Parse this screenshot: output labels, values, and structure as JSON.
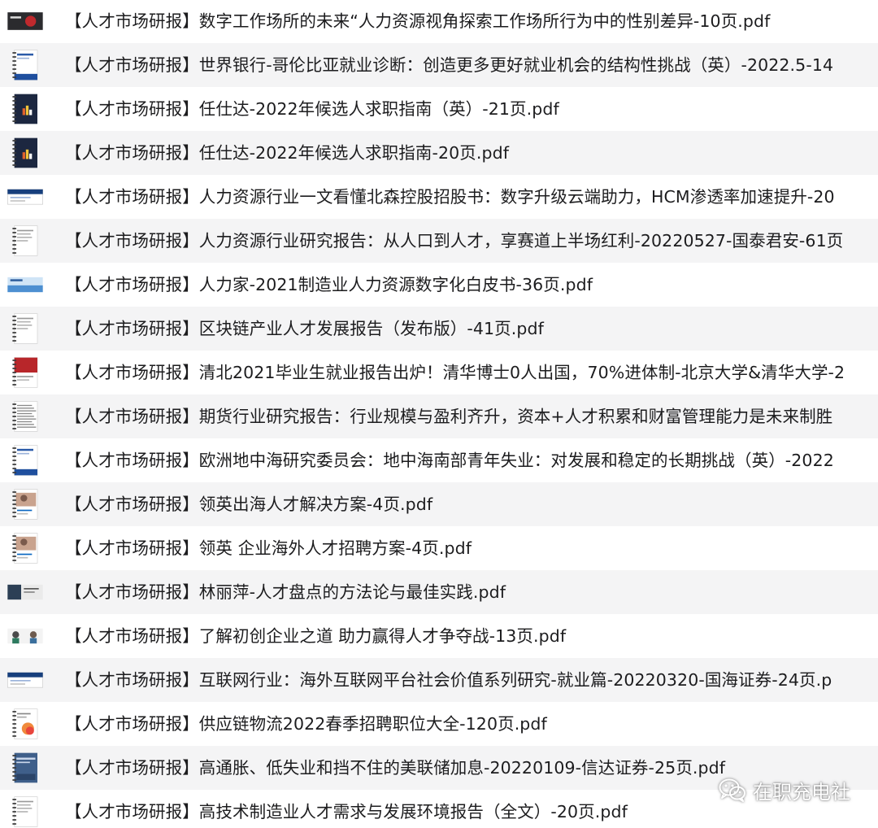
{
  "files": [
    {
      "name": "【人才市场研报】数字工作场所的未来“人力资源视角探索工作场所行为中的性别差异-10页.pdf",
      "thumb": "cover-wide-dark-red"
    },
    {
      "name": "【人才市场研报】世界银行-哥伦比亚就业诊断：创造更多更好就业机会的结构性挑战（英）-2022.5-14",
      "thumb": "doc-portrait-blue"
    },
    {
      "name": "【人才市场研报】任仕达-2022年候选人求职指南（英）-21页.pdf",
      "thumb": "cover-navy"
    },
    {
      "name": "【人才市场研报】任仕达-2022年候选人求职指南-20页.pdf",
      "thumb": "cover-navy"
    },
    {
      "name": "【人才市场研报】人力资源行业一文看懂北森控股招股书：数字升级云端助力，HCM渗透率加速提升-20",
      "thumb": "slide-wide-blue"
    },
    {
      "name": "【人才市场研报】人力资源行业研究报告：从人口到人才，享赛道上半场红利-20220527-国泰君安-61页",
      "thumb": "doc-portrait-plain"
    },
    {
      "name": "【人才市场研报】人力家-2021制造业人力资源数字化白皮书-36页.pdf",
      "thumb": "slide-wide-lightblue"
    },
    {
      "name": "【人才市场研报】区块链产业人才发展报告（发布版）-41页.pdf",
      "thumb": "doc-portrait-plain"
    },
    {
      "name": "【人才市场研报】清北2021毕业生就业报告出炉！清华博士0人出国，70%进体制-北京大学&清华大学-2",
      "thumb": "doc-portrait-red"
    },
    {
      "name": "【人才市场研报】期货行业研究报告：行业规模与盈利齐升，资本+人才积累和财富管理能力是未来制胜",
      "thumb": "doc-portrait-dense"
    },
    {
      "name": "【人才市场研报】欧洲地中海研究委员会：地中海南部青年失业：对发展和稳定的长期挑战（英）-2022",
      "thumb": "doc-portrait-blue"
    },
    {
      "name": "【人才市场研报】领英出海人才解决方案-4页.pdf",
      "thumb": "doc-portrait-photo"
    },
    {
      "name": "【人才市场研报】领英 企业海外人才招聘方案-4页.pdf",
      "thumb": "doc-portrait-photo"
    },
    {
      "name": "【人才市场研报】林丽萍-人才盘点的方法论与最佳实践.pdf",
      "thumb": "slide-wide-dark"
    },
    {
      "name": "【人才市场研报】了解初创企业之道 助力赢得人才争夺战-13页.pdf",
      "thumb": "slide-wide-people"
    },
    {
      "name": "【人才市场研报】互联网行业：海外互联网平台社会价值系列研究-就业篇-20220320-国海证券-24页.p",
      "thumb": "slide-wide-blue"
    },
    {
      "name": "【人才市场研报】供应链物流2022春季招聘职位大全-120页.pdf",
      "thumb": "doc-portrait-orange"
    },
    {
      "name": "【人才市场研报】高通胀、低失业和挡不住的美联储加息-20220109-信达证券-25页.pdf",
      "thumb": "cover-blue-steel"
    },
    {
      "name": "【人才市场研报】高技术制造业人才需求与发展环境报告（全文）-20页.pdf",
      "thumb": "doc-portrait-plain"
    }
  ],
  "watermark": {
    "text": "在职充电社",
    "icon": "wechat-icon"
  }
}
